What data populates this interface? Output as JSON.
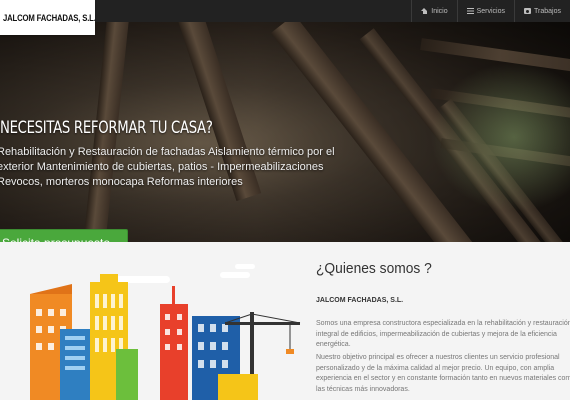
{
  "brand": {
    "name": "JALCOM FACHADAS, S.L."
  },
  "nav": {
    "items": [
      {
        "label": "Inicio",
        "icon": "home-icon"
      },
      {
        "label": "Servicios",
        "icon": "list-icon"
      },
      {
        "label": "Trabajos",
        "icon": "camera-icon"
      }
    ]
  },
  "hero": {
    "title": "NECESITAS REFORMAR TU CASA?",
    "text": "Rehabilitación y Restauración de fachadas Aislamiento térmico por el exterior Mantenimiento de cubiertas, patios - Impermeabilizaciones Revocos, morteros monocapa Reformas interiores",
    "cta_label": "Solicita presupuesto",
    "prev_label": "‹",
    "next_label": "›"
  },
  "about": {
    "title": "¿Quienes somos ?",
    "company": "JALCOM FACHADAS, S.L.",
    "paragraph1": "Somos una empresa constructora especializada en la rehabilitación y restauración integral de edificios, impermeabilización de cubiertas y mejora de la eficiencia energética.",
    "paragraph2": "Nuestro objetivo principal es ofrecer a nuestros clientes un servicio profesional personalizado y de la máxima calidad al mejor precio. Un equipo, con amplia experiencia en el sector y en constante formación tanto en nuevos materiales como en las técnicas más innovadoras."
  },
  "colors": {
    "navbar": "#222222",
    "cta": "#4aa83c",
    "accent_orange": "#f08a24",
    "accent_blue": "#2f7fc1"
  }
}
